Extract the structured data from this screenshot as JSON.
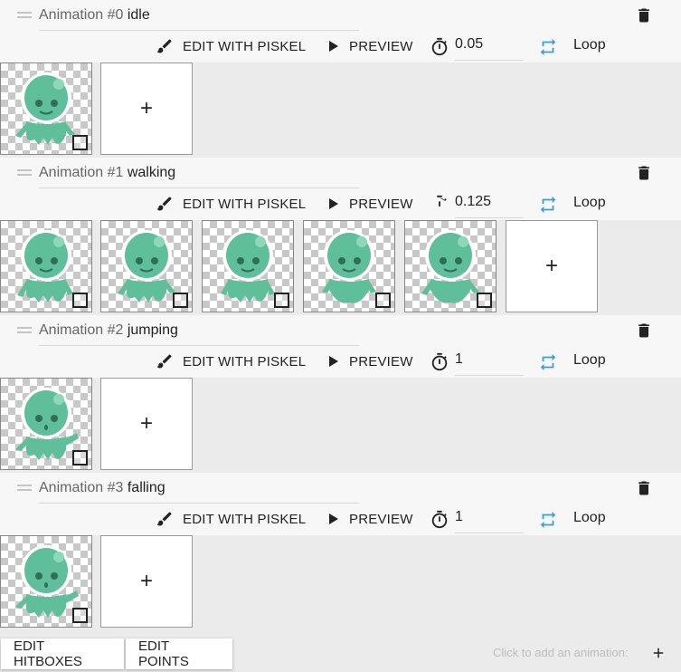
{
  "animations": [
    {
      "label": "Animation #0",
      "name": "idle",
      "timer": "0.05",
      "loop": "Loop",
      "frame_count": 1
    },
    {
      "label": "Animation #1",
      "name": "walking",
      "timer": "0.125",
      "loop": "Loop",
      "frame_count": 5
    },
    {
      "label": "Animation #2",
      "name": "jumping",
      "timer": "1",
      "loop": "Loop",
      "frame_count": 1
    },
    {
      "label": "Animation #3",
      "name": "falling",
      "timer": "1",
      "loop": "Loop",
      "frame_count": 1
    }
  ],
  "buttons": {
    "edit_piskel": "EDIT WITH PISKEL",
    "preview": "PREVIEW",
    "add_frame": "+"
  },
  "footer": {
    "edit_hitboxes": "EDIT HITBOXES",
    "edit_points": "EDIT POINTS",
    "add_hint": "Click to add an animation:"
  },
  "icons": {
    "drag": "drag-handle-icon",
    "trash": "trash-icon",
    "brush": "brush-icon",
    "play": "play-icon",
    "timer": "timer-icon",
    "loop": "loop-icon",
    "add": "plus-icon"
  },
  "colors": {
    "accent": "#7b2fbe",
    "loop": "#3aa0d6",
    "alien": "#5fbf9a"
  }
}
